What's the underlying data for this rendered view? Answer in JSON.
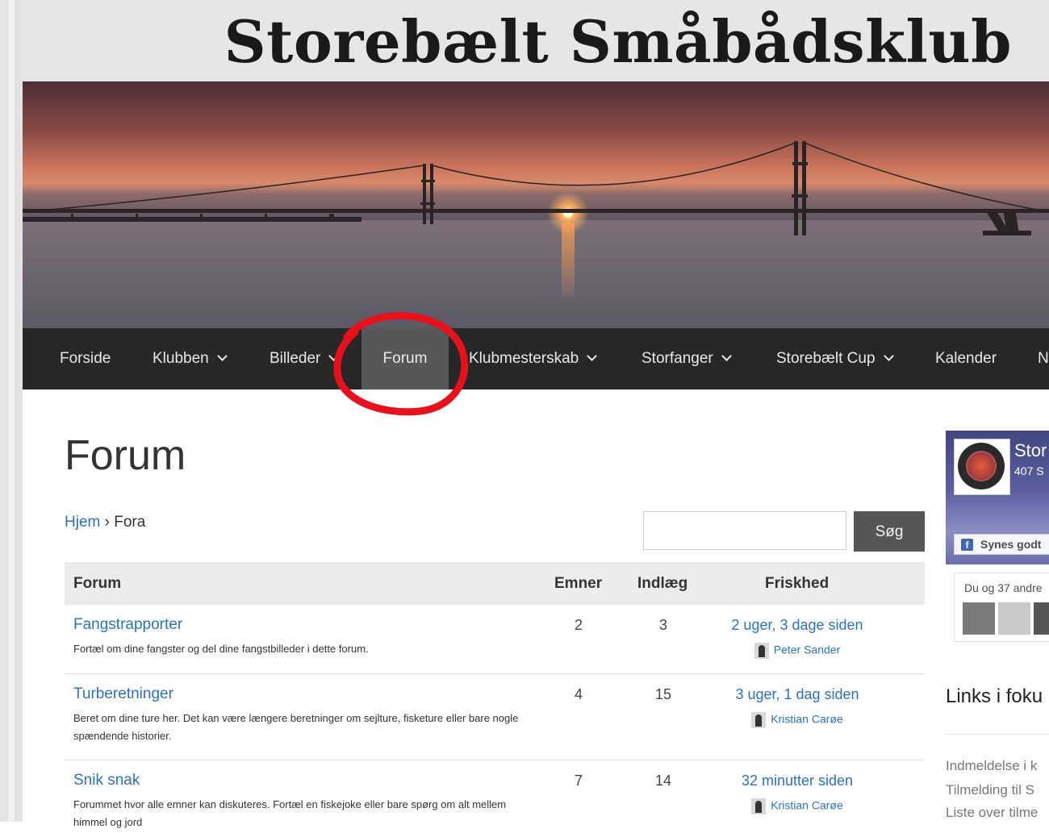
{
  "site": {
    "title": "Storebælt Småbådsklub"
  },
  "nav": {
    "items": [
      {
        "label": "Forside"
      },
      {
        "label": "Klubben"
      },
      {
        "label": "Billeder"
      },
      {
        "label": "Forum"
      },
      {
        "label": "Klubmesterskab"
      },
      {
        "label": "Storfanger"
      },
      {
        "label": "Storebælt Cup"
      },
      {
        "label": "Kalender"
      },
      {
        "label": "N"
      }
    ],
    "active": "Forum",
    "annotation_color": "#e8101a"
  },
  "page": {
    "title": "Forum",
    "breadcrumb": {
      "home": "Hjem",
      "separator": "›",
      "current": "Fora"
    },
    "search": {
      "placeholder": "",
      "button": "Søg"
    }
  },
  "forum_table": {
    "headers": {
      "forum": "Forum",
      "topics": "Emner",
      "posts": "Indlæg",
      "freshness": "Friskhed"
    },
    "rows": [
      {
        "name": "Fangstrapporter",
        "description": "Fortæl om dine fangster og del dine fangstbilleder i dette forum.",
        "topics": "2",
        "posts": "3",
        "freshness": "2 uger, 3 dage siden",
        "user": "Peter Sander"
      },
      {
        "name": "Turberetninger",
        "description": "Beret om dine ture her. Det kan være længere beretninger om sejlture, fisketure eller bare nogle spændende historier.",
        "topics": "4",
        "posts": "15",
        "freshness": "3 uger, 1 dag siden",
        "user": "Kristian Carøe"
      },
      {
        "name": "Snik snak",
        "description": "Forummet hvor alle emner kan diskuteres. Fortæl en fiskejoke eller bare spørg om alt mellem himmel og jord",
        "topics": "7",
        "posts": "14",
        "freshness": "32 minutter siden",
        "user": "Kristian Carøe"
      }
    ]
  },
  "facebook": {
    "page_name": "Stor",
    "followers": "407 S",
    "like_button": "Synes godt",
    "like_icon": "f",
    "friends_text": "Du og 37 andre"
  },
  "sidebar": {
    "links_heading": "Links i foku",
    "links": [
      "Indmeldelse i k",
      "Tilmelding til S",
      "Liste over tilme"
    ]
  },
  "colors": {
    "link": "#2e72b8",
    "nav_bg": "#272727",
    "nav_active": "#575757",
    "search_button": "#555555"
  }
}
